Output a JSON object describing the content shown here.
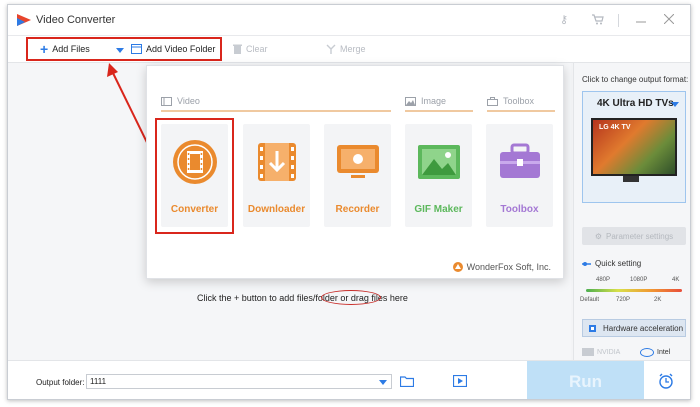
{
  "window": {
    "title": "Video Converter"
  },
  "toolbar": {
    "add_files": "Add Files",
    "add_video_folder": "Add Video Folder",
    "clear": "Clear",
    "merge": "Merge"
  },
  "popup": {
    "categories": {
      "video": "Video",
      "image": "Image",
      "toolbox": "Toolbox"
    },
    "tiles": [
      {
        "label": "Converter",
        "icon": "film-reel-icon"
      },
      {
        "label": "Downloader",
        "icon": "download-film-icon"
      },
      {
        "label": "Recorder",
        "icon": "screen-record-icon"
      },
      {
        "label": "GIF Maker",
        "icon": "image-icon"
      },
      {
        "label": "Toolbox",
        "icon": "toolbox-icon"
      }
    ],
    "brand": "WonderFox Soft, Inc."
  },
  "main": {
    "hint_prefix": "Click the + button to add files/folder or",
    "hint_link": "drag files here"
  },
  "right_panel": {
    "title": "Click to change output format:",
    "format": "4K Ultra HD TVs",
    "tv_label": "LG 4K TV",
    "parameter_settings": "Parameter settings",
    "quick_setting": "Quick setting",
    "slider_top": [
      "480P",
      "1080P",
      "4K"
    ],
    "slider_bottom": [
      "Default",
      "720P",
      "2K"
    ],
    "hardware_acceleration": "Hardware acceleration",
    "gpu": {
      "nvidia": "NVIDIA",
      "intel": "Intel"
    }
  },
  "bottom": {
    "output_label": "Output folder:",
    "output_value": "1111",
    "run": "Run"
  },
  "colors": {
    "accent_orange": "#ea8a2e",
    "accent_blue": "#2d7be5",
    "annotation_red": "#d9261c",
    "tile_purple": "#a478d4",
    "tile_green": "#5cb85c"
  }
}
